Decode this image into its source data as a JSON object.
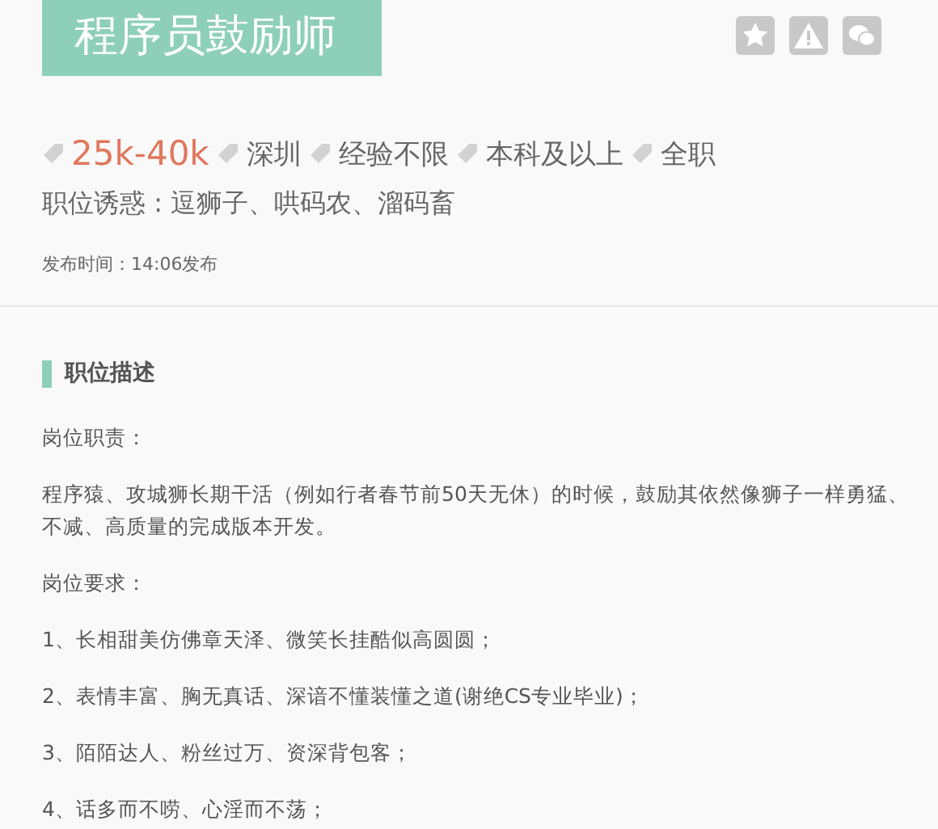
{
  "title": "程序员鼓励师",
  "actions": [
    {
      "kind": "star"
    },
    {
      "kind": "warning"
    },
    {
      "kind": "wechat"
    }
  ],
  "tags": [
    {
      "kind": "salary",
      "text": "25k-40k"
    },
    {
      "kind": "plain",
      "text": "深圳"
    },
    {
      "kind": "plain",
      "text": "经验不限"
    },
    {
      "kind": "plain",
      "text": "本科及以上"
    },
    {
      "kind": "plain",
      "text": "全职"
    }
  ],
  "perks": "职位诱惑 : 逗狮子、哄码农、溜码畜",
  "publish_time": "发布时间：14:06发布",
  "section_title": "职位描述",
  "blocks": [
    {
      "lines": [
        "岗位职责："
      ]
    },
    {
      "lines": [
        "程序猿、攻城狮长期干活（例如行者春节前50天无休）的时候，鼓励其依然像狮子一样勇猛、",
        "不减、高质量的完成版本开发。"
      ]
    },
    {
      "lines": [
        "岗位要求："
      ]
    },
    {
      "lines": [
        "1、长相甜美仿佛章天泽、微笑长挂酷似高圆圆；"
      ]
    },
    {
      "lines": [
        "2、表情丰富、胸无真话、深谙不懂装懂之道(谢绝CS专业毕业)；"
      ]
    },
    {
      "lines": [
        "3、陌陌达人、粉丝过万、资深背包客；"
      ]
    },
    {
      "lines": [
        "4、话多而不唠、心淫而不荡；"
      ]
    }
  ]
}
